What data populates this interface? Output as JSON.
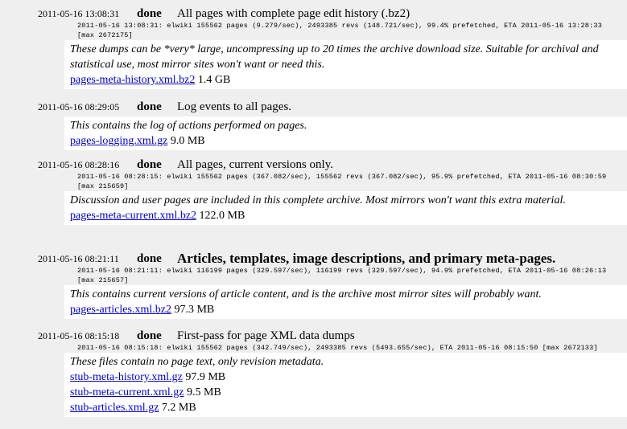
{
  "jobs": [
    {
      "timestamp": "2011-05-16 13:08:31",
      "status": "done",
      "title": "All pages with complete page edit history (.bz2)",
      "progress": "2011-05-16 13:08:31: elwiki 155562 pages (9.279/sec), 2493385 revs (148.721/sec), 99.4% prefetched, ETA 2011-05-16 13:28:33 [max 2672175]",
      "description": "These dumps can be *very* large, uncompressing up to 20 times the archive download size. Suitable for archival and statistical use, most mirror sites won't want or need this.",
      "files": [
        {
          "name": "pages-meta-history.xml.bz2",
          "size": "1.4 GB"
        }
      ]
    },
    {
      "timestamp": "2011-05-16 08:29:05",
      "status": "done",
      "title": "Log events to all pages.",
      "progress": "",
      "description": "This contains the log of actions performed on pages.",
      "files": [
        {
          "name": "pages-logging.xml.gz",
          "size": "9.0 MB"
        }
      ]
    },
    {
      "timestamp": "2011-05-16 08:28:16",
      "status": "done",
      "title": "All pages, current versions only.",
      "progress": "2011-05-16 08:28:15: elwiki 155562 pages (367.082/sec), 155562 revs (367.082/sec), 95.9% prefetched, ETA 2011-05-16 08:30:59 [max 215659]",
      "description": "Discussion and user pages are included in this complete archive. Most mirrors won't want this extra material.",
      "files": [
        {
          "name": "pages-meta-current.xml.bz2",
          "size": "122.0 MB"
        }
      ]
    },
    {
      "timestamp": "2011-05-16 08:21:11",
      "status": "done",
      "title": "Articles, templates, image descriptions, and primary meta-pages.",
      "progress": "2011-05-16 08:21:11: elwiki 116199 pages (329.597/sec), 116199 revs (329.597/sec), 94.9% prefetched, ETA 2011-05-16 08:26:13 [max 215657]",
      "description": "This contains current versions of article content, and is the archive most mirror sites will probably want.",
      "files": [
        {
          "name": "pages-articles.xml.bz2",
          "size": "97.3 MB"
        }
      ]
    },
    {
      "timestamp": "2011-05-16 08:15:18",
      "status": "done",
      "title": "First-pass for page XML data dumps",
      "progress": "2011-05-16 08:15:18: elwiki 155562 pages (342.749/sec), 2493385 revs (5493.655/sec), ETA 2011-05-16 08:15:50 [max 2672133]",
      "description": "These files contain no page text, only revision metadata.",
      "files": [
        {
          "name": "stub-meta-history.xml.gz",
          "size": "97.9 MB"
        },
        {
          "name": "stub-meta-current.xml.gz",
          "size": "9.5 MB"
        },
        {
          "name": "stub-articles.xml.gz",
          "size": "7.2 MB"
        }
      ]
    }
  ]
}
